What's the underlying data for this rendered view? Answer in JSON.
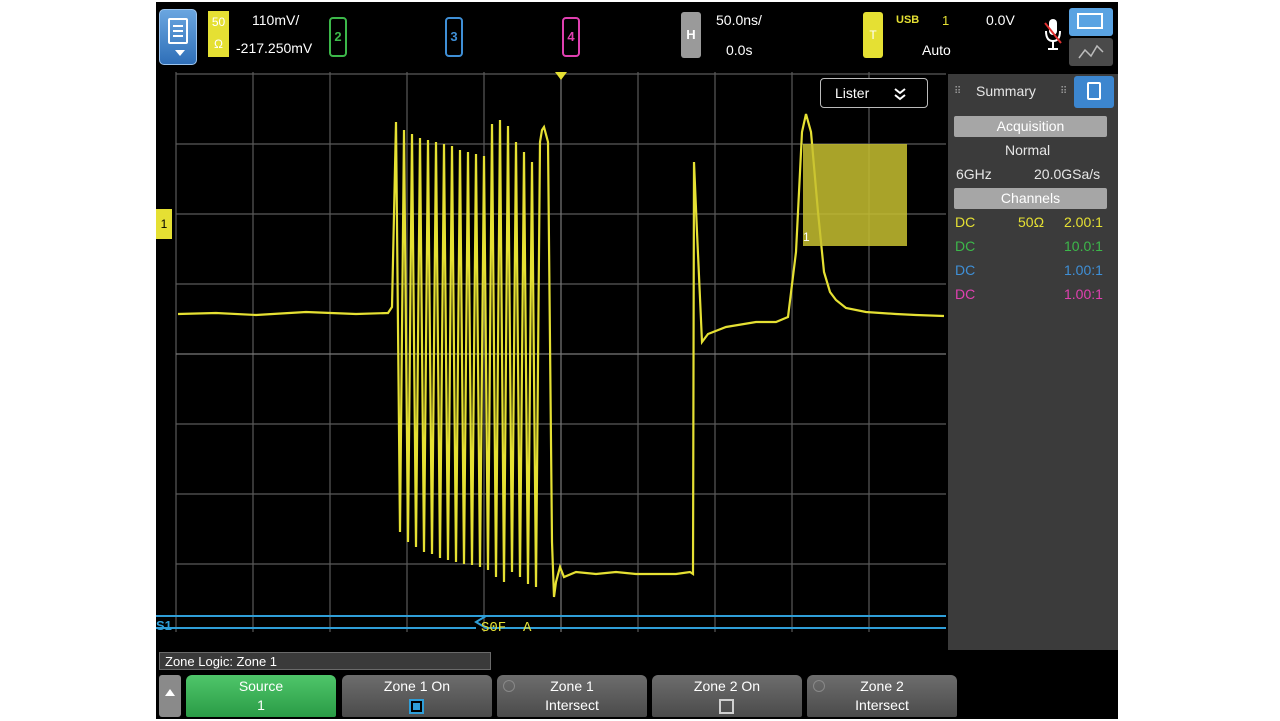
{
  "topbar": {
    "ch1_badge_top": "50",
    "ch1_badge_bottom": "Ω",
    "ch1_scale": "110mV/",
    "ch1_offset": "-217.250mV",
    "ch2_label": "2",
    "ch3_label": "3",
    "ch4_label": "4",
    "horizontal_label": "H",
    "horizontal_scale": "50.0ns/",
    "horizontal_delay": "0.0s",
    "trigger_label": "T",
    "trigger_type": "USB",
    "trigger_source": "1",
    "trigger_level": "0.0V",
    "trigger_mode": "Auto"
  },
  "waveform": {
    "ch1_marker": "1",
    "serial_marker": "S1",
    "decode_label": "S0F  A",
    "zone_label": "1",
    "lister_button": "Lister"
  },
  "panel": {
    "tab_label": "Summary",
    "acquisition_header": "Acquisition",
    "acq_mode": "Normal",
    "bandwidth": "6GHz",
    "sample_rate": "20.0GSa/s",
    "channels_header": "Channels",
    "channels": [
      {
        "coupling": "DC",
        "impedance": "50Ω",
        "probe": "2.00:1",
        "color": "#e5e033"
      },
      {
        "coupling": "DC",
        "impedance": "",
        "probe": "10.0:1",
        "color": "#3cb84a"
      },
      {
        "coupling": "DC",
        "impedance": "",
        "probe": "1.00:1",
        "color": "#3f8fd6"
      },
      {
        "coupling": "DC",
        "impedance": "",
        "probe": "1.00:1",
        "color": "#e040b0"
      }
    ]
  },
  "softkeys": {
    "menu_title": "Zone Logic: Zone 1",
    "source_label": "Source",
    "source_value": "1",
    "zone1_on_label": "Zone 1 On",
    "zone1_mode_label": "Zone 1",
    "zone1_mode_value": "Intersect",
    "zone2_on_label": "Zone 2 On",
    "zone2_mode_label": "Zone 2",
    "zone2_mode_value": "Intersect"
  },
  "colors": {
    "ch1": "#e5e033",
    "ch2": "#3cb84a",
    "ch3": "#3f8fd6",
    "ch4": "#e040b0",
    "serial": "#2f9ed8"
  }
}
